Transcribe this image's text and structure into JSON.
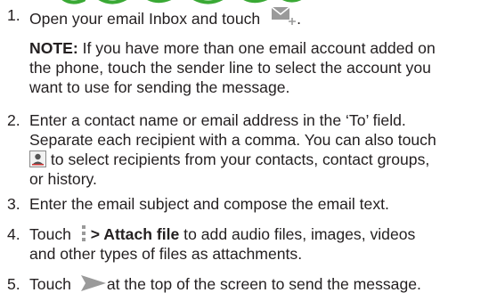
{
  "steps": [
    {
      "num": "1.",
      "text_before": "Open your email Inbox and touch",
      "text_after": ".",
      "icon": "compose-email-icon"
    },
    {
      "num": "2.",
      "line1": "Enter a contact name or email address in the ‘To’ field.",
      "line2": "Separate each recipient with a comma. You can also touch",
      "line3_after": " to select recipients from your contacts, contact groups,",
      "line4": "or history.",
      "icon": "contact-picker-icon"
    },
    {
      "num": "3.",
      "text": "Enter the email subject and compose the email text."
    },
    {
      "num": "4.",
      "text_before": "Touch",
      "bold": " > Attach file",
      "text_after": " to add audio files, images, videos",
      "line2": "and other types of files as attachments.",
      "icon": "menu-dots-icon"
    },
    {
      "num": "5.",
      "text_before": "Touch",
      "text_after": "at the top of the screen to send the message.",
      "icon": "send-icon"
    }
  ],
  "note": {
    "label": "NOTE:",
    "line1": " If you have more than one email account added on",
    "line2": "the phone, touch the sender line to select the account you",
    "line3": "want to use for sending the message."
  },
  "colors": {
    "text": "#231f20",
    "icon_gray": "#9a9a9a",
    "heading_green": "#3aa935"
  }
}
